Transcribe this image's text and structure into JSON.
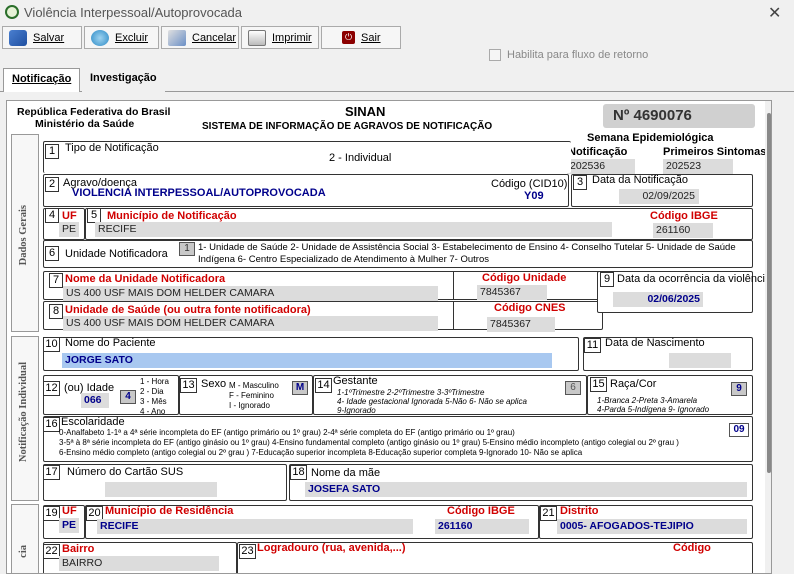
{
  "window": {
    "title": "Violência Interpessoal/Autoprovocada"
  },
  "toolbar": {
    "salvar": "Salvar",
    "excluir": "Excluir",
    "cancelar": "Cancelar",
    "imprimir": "Imprimir",
    "sair": "Sair"
  },
  "habilita": "Habilita para fluxo de retorno",
  "tabs": {
    "notificacao": "Notificação",
    "investigacao": "Investigação"
  },
  "header": {
    "rep": "República Federativa do Brasil",
    "ministerio": "Ministério da Saúde",
    "sinan": "SINAN",
    "sistema": "SISTEMA DE INFORMAÇÃO  DE AGRAVOS DE NOTIFICAÇÃO",
    "numero": "Nº 4690076"
  },
  "semana": {
    "title": "Semana Epidemiológica",
    "notif_label": "Notificação",
    "sint_label": "Primeiros Sintomas",
    "notif": "202536",
    "sint": "202523"
  },
  "f1": {
    "n": "1",
    "label": "Tipo de Notificação",
    "value": "2 - Individual"
  },
  "f2": {
    "n": "2",
    "label": "Agravo/doença",
    "value": "VIOLENCIA INTERPESSOAL/AUTOPROVOCADA",
    "cid_label": "Código (CID10)",
    "cid": "Y09"
  },
  "f3": {
    "n": "3",
    "label": "Data da Notificação",
    "value": "02/09/2025"
  },
  "f4": {
    "n": "4",
    "label": "UF",
    "value": "PE"
  },
  "f5": {
    "n": "5",
    "label": "Município de Notificação",
    "value": "RECIFE",
    "ibge_label": "Código IBGE",
    "ibge": "261160"
  },
  "f6": {
    "n": "6",
    "label": "Unidade Notificadora",
    "code": "1",
    "options": "1- Unidade de Saúde   2- Unidade de Assistência Social  3- Estabelecimento de Ensino   4- Conselho Tutelar  5- Unidade de Saúde Indígena  6- Centro Especializado de Atendimento à Mulher  7- Outros"
  },
  "f7": {
    "n": "7",
    "label": "Nome da Unidade Notificadora",
    "value": "US 400 USF MAIS DOM HELDER CAMARA",
    "cod_label": "Código Unidade",
    "cod": "7845367"
  },
  "f8": {
    "n": "8",
    "label": "Unidade de Saúde (ou outra fonte notificadora)",
    "value": "US 400 USF MAIS DOM HELDER CAMARA",
    "cnes_label": "Código CNES",
    "cnes": "7845367"
  },
  "f9": {
    "n": "9",
    "label": "Data da ocorrência da violência",
    "value": "02/06/2025"
  },
  "side": {
    "dados_gerais": "Dados Gerais",
    "notif_ind": "Notificação Individual",
    "res": "cia"
  },
  "f10": {
    "n": "10",
    "label": "Nome do Paciente",
    "value": "JORGE SATO"
  },
  "f11": {
    "n": "11",
    "label": "Data de Nascimento",
    "value": ""
  },
  "f12": {
    "n": "12",
    "label": "(ou) Idade",
    "value": "066",
    "unit": "4",
    "opts": [
      "1 - Hora",
      "2 - Dia",
      "3 - Mês",
      "4 - Ano"
    ]
  },
  "f13": {
    "n": "13",
    "label": "Sexo",
    "value": "M",
    "opts": [
      "M - Masculino",
      "F - Feminino",
      "I - Ignorado"
    ]
  },
  "f14": {
    "n": "14",
    "label": "Gestante",
    "value": "6",
    "opts1": "1-1ºTrimestre  2-2ºTrimestre   3-3ºTrimestre",
    "opts2": "4- Idade gestacional Ignorada   5-Não   6- Não se aplica",
    "opts3": "9-Ignorado"
  },
  "f15": {
    "n": "15",
    "label": "Raça/Cor",
    "value": "9",
    "opts1": "1-Branca   2-Preta    3-Amarela",
    "opts2": "4-Parda   5-Indígena   9- Ignorado"
  },
  "f16": {
    "n": "16",
    "label": "Escolaridade",
    "value": "09",
    "l1": "0-Analfabeto    1-1ª a 4ª série incompleta do EF (antigo primário ou 1º grau)    2-4ª série completa do EF (antigo primário ou 1º grau)",
    "l2": "3-5ª à 8ª série incompleta do EF (antigo ginásio ou 1º grau)    4-Ensino fundamental completo (antigo ginásio ou 1º grau)    5-Ensino médio incompleto (antigo colegial  ou 2º grau )",
    "l3": "6-Ensino médio completo (antigo colegial  ou 2º grau )    7-Educação superior incompleta    8-Educação superior completa    9-Ignorado    10- Não se aplica"
  },
  "f17": {
    "n": "17",
    "label": "Número do Cartão SUS",
    "value": ""
  },
  "f18": {
    "n": "18",
    "label": "Nome da mãe",
    "value": "JOSEFA SATO"
  },
  "f19": {
    "n": "19",
    "label": "UF",
    "value": "PE"
  },
  "f20": {
    "n": "20",
    "label": "Município de Residência",
    "value": "RECIFE",
    "ibge_label": "Código IBGE",
    "ibge": "261160"
  },
  "f21": {
    "n": "21",
    "label": "Distrito",
    "value": "0005- AFOGADOS-TEJIPIO"
  },
  "f22": {
    "n": "22",
    "label": "Bairro",
    "value": "BAIRRO"
  },
  "f23": {
    "n": "23",
    "label": "Logradouro (rua, avenida,...)",
    "code_label": "Código"
  }
}
